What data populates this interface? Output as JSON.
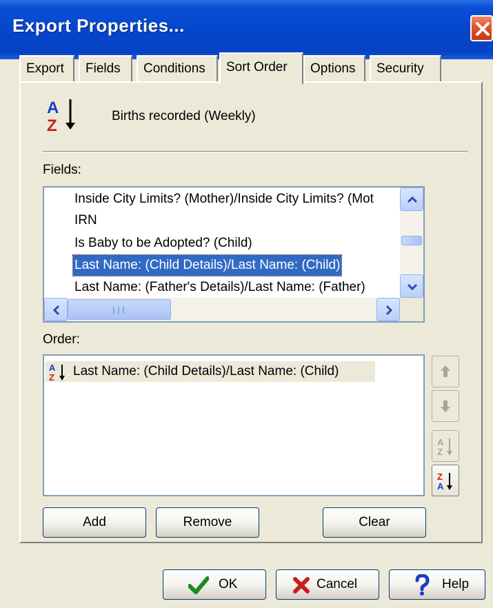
{
  "window": {
    "title": "Export Properties..."
  },
  "tabs": [
    {
      "label": "Export"
    },
    {
      "label": "Fields"
    },
    {
      "label": "Conditions"
    },
    {
      "label": "Sort Order",
      "active": true
    },
    {
      "label": "Options"
    },
    {
      "label": "Security"
    }
  ],
  "report": {
    "name": "Births recorded (Weekly)"
  },
  "fields": {
    "label": "Fields:",
    "items": [
      "Inside City Limits? (Mother)/Inside City Limits? (Mot",
      "IRN",
      "Is Baby to be Adopted? (Child)",
      "Last Name: (Child Details)/Last Name: (Child)",
      "Last Name: (Father's Details)/Last Name: (Father)"
    ],
    "selected_index": 3
  },
  "order": {
    "label": "Order:",
    "items": [
      {
        "label": "Last Name: (Child Details)/Last Name: (Child)",
        "direction": "ascending"
      }
    ]
  },
  "buttons": {
    "add": "Add",
    "remove": "Remove",
    "clear": "Clear",
    "ok": "OK",
    "cancel": "Cancel",
    "help": "Help"
  },
  "icons": {
    "sort_ascending": "sort-az-icon",
    "sort_descending": "sort-za-icon",
    "move_up": "arrow-up-icon",
    "move_down": "arrow-down-icon"
  },
  "colors": {
    "titlebar": "#0646cc",
    "selection": "#316ac5",
    "ok_check": "#1e8a1e",
    "cancel_x": "#c81e1e",
    "help_q": "#1a3cc8"
  }
}
